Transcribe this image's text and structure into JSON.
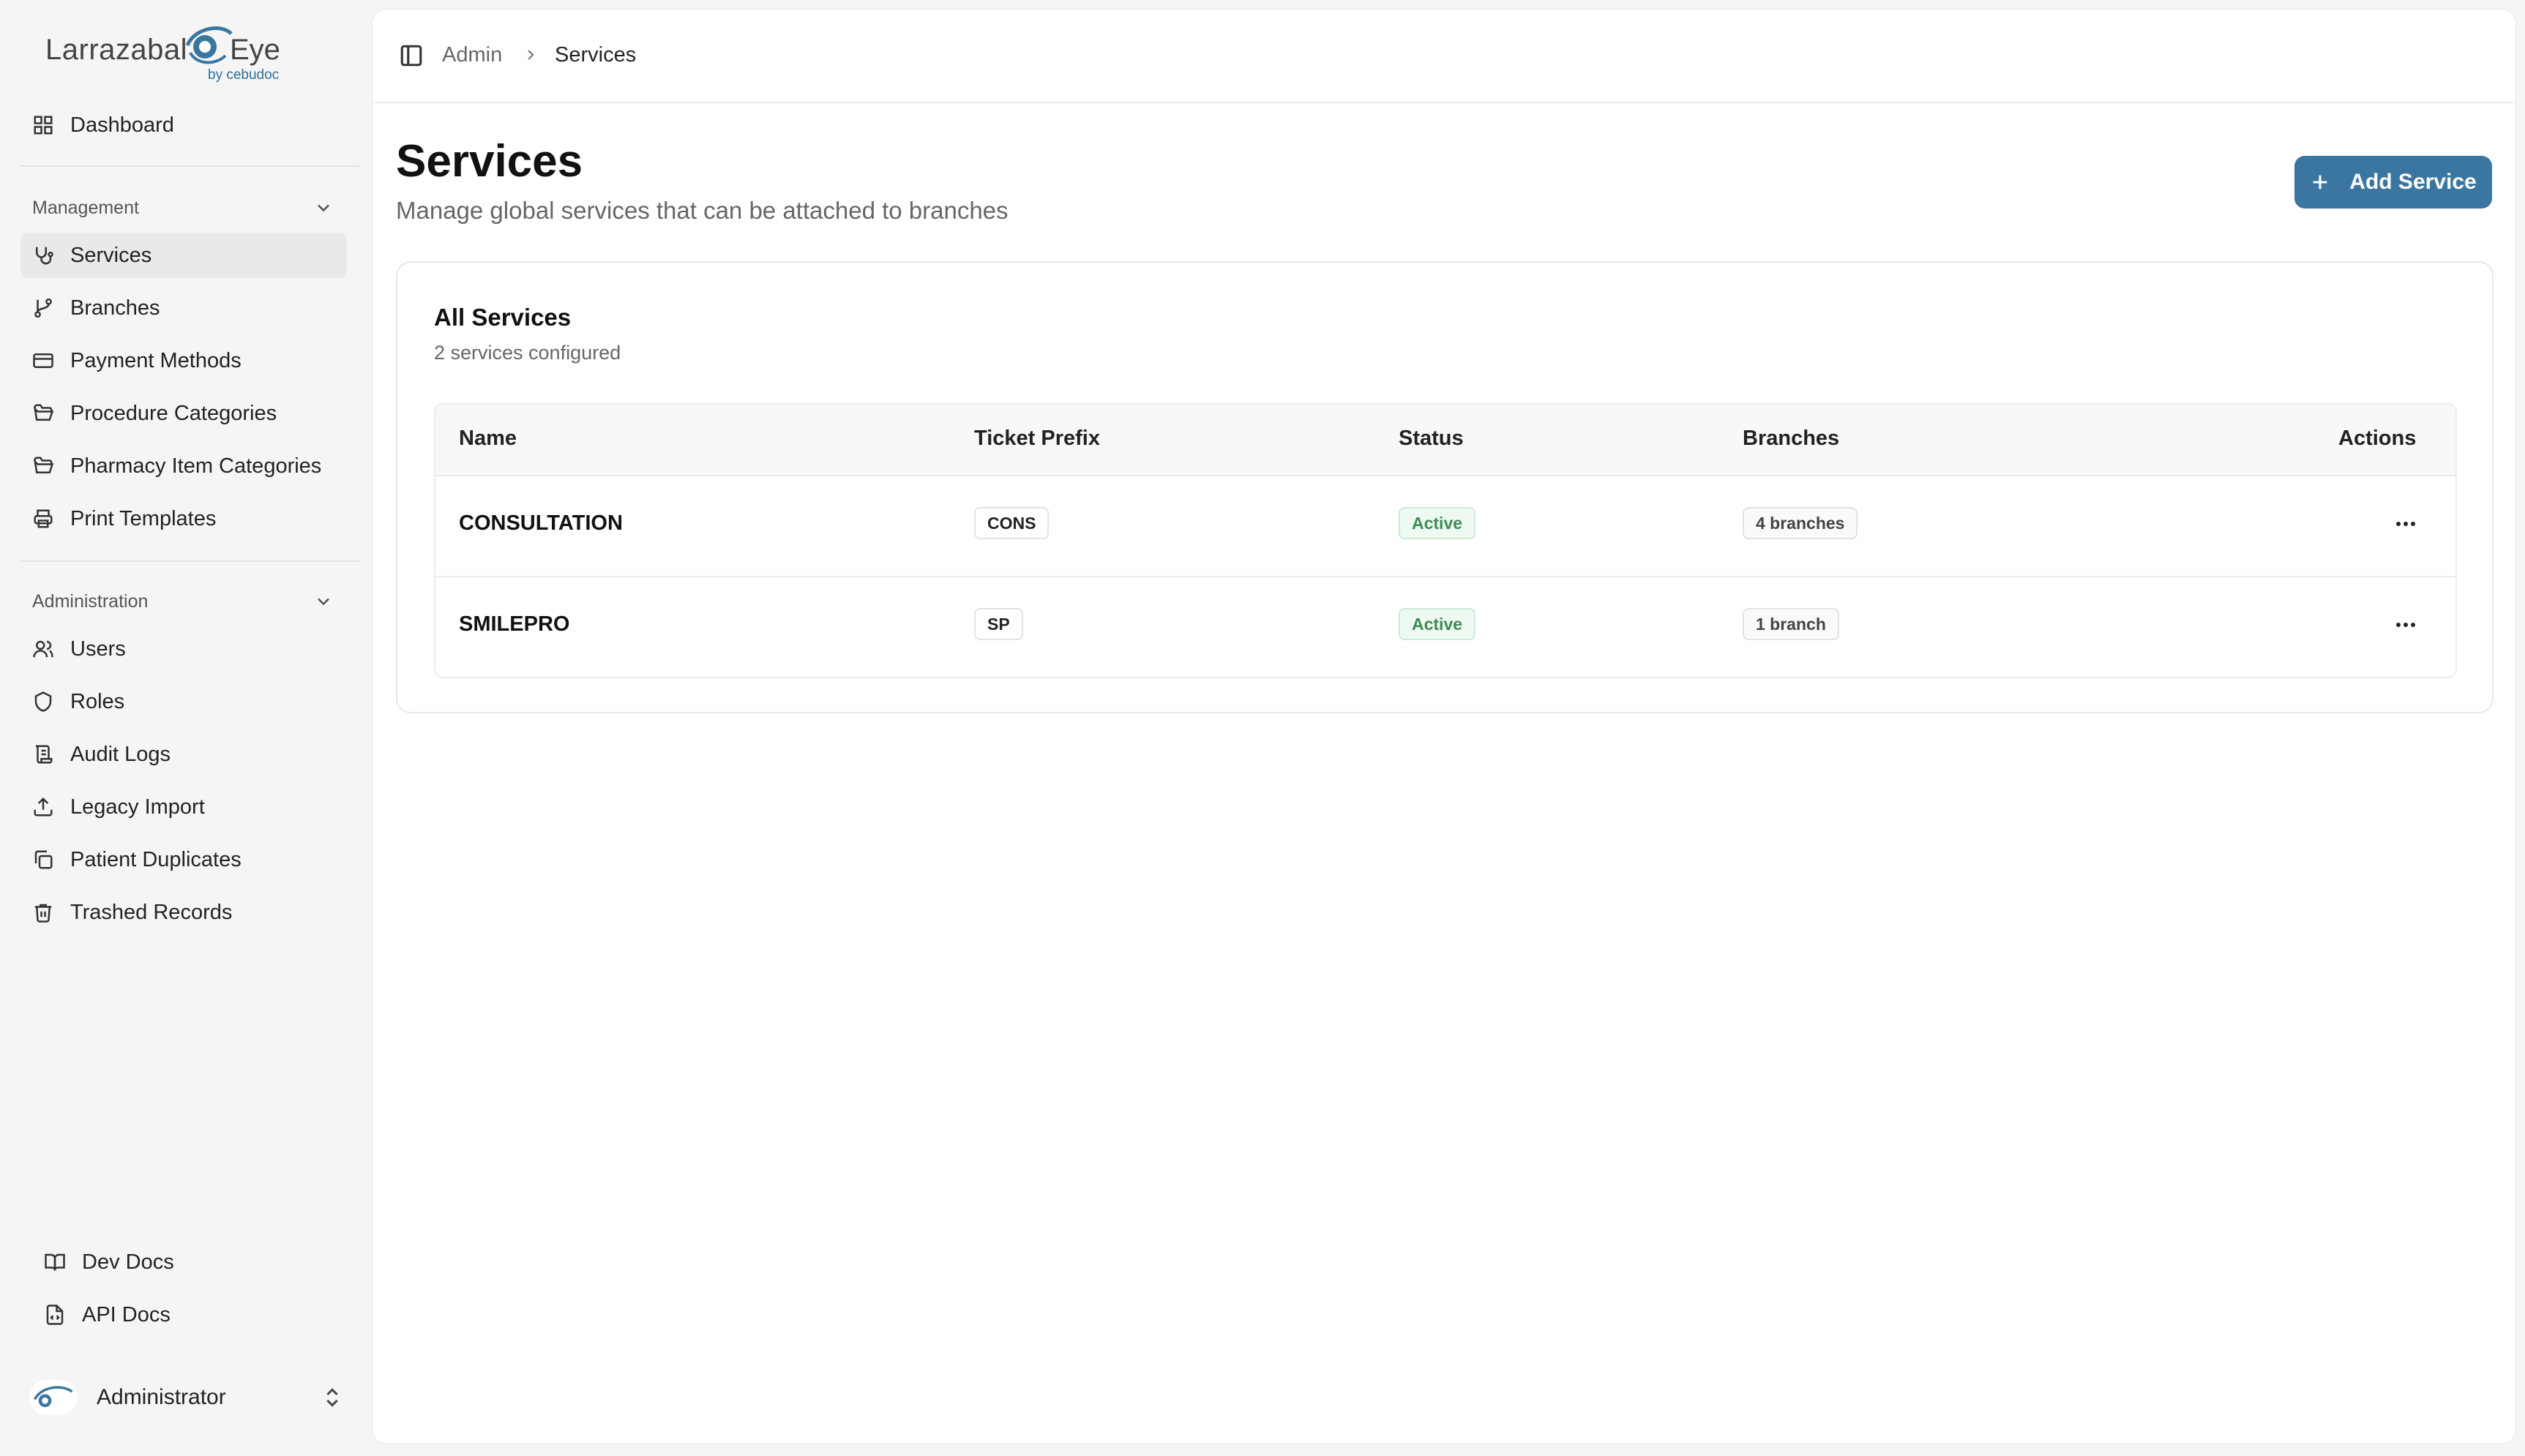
{
  "brand": {
    "name_part1": "Larrazabal",
    "name_part2": "Eye",
    "sub": "by cebudoc",
    "accent": "#3b76a0"
  },
  "sidebar": {
    "dashboard": "Dashboard",
    "management": {
      "label": "Management",
      "items": [
        "Services",
        "Branches",
        "Payment Methods",
        "Procedure Categories",
        "Pharmacy Item Categories",
        "Print Templates"
      ]
    },
    "administration": {
      "label": "Administration",
      "items": [
        "Users",
        "Roles",
        "Audit Logs",
        "Legacy Import",
        "Patient Duplicates",
        "Trashed Records"
      ]
    },
    "footer_links": [
      "Dev Docs",
      "API Docs"
    ],
    "user": {
      "name": "Administrator"
    }
  },
  "breadcrumb": {
    "parent": "Admin",
    "current": "Services"
  },
  "page": {
    "title": "Services",
    "subtitle": "Manage global services that can be attached to branches",
    "add_button": "Add Service"
  },
  "card": {
    "title": "All Services",
    "subtitle": "2 services configured",
    "columns": [
      "Name",
      "Ticket Prefix",
      "Status",
      "Branches",
      "Actions"
    ],
    "rows": [
      {
        "name": "CONSULTATION",
        "prefix": "CONS",
        "status": "Active",
        "branches": "4 branches"
      },
      {
        "name": "SMILEPRO",
        "prefix": "SP",
        "status": "Active",
        "branches": "1 branch"
      }
    ]
  }
}
